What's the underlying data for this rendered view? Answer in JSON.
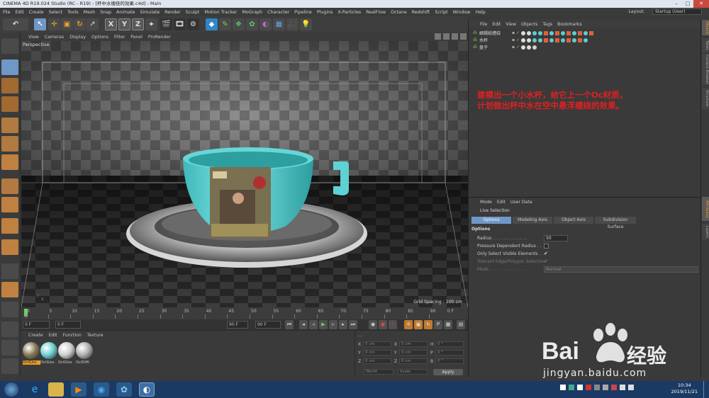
{
  "window": {
    "title": "CINEMA 4D R19.024 Studio (RC - R19) - [杯中水缠绕的效果.c4d] - Main",
    "controls": [
      "–",
      "□",
      "✕"
    ]
  },
  "menubar": {
    "items": [
      "File",
      "Edit",
      "Create",
      "Select",
      "Tools",
      "Mesh",
      "Snap",
      "Animate",
      "Simulate",
      "Render",
      "Sculpt",
      "Motion Tracker",
      "MoGraph",
      "Character",
      "Pipeline",
      "Plugins",
      "X-Particles",
      "RealFlow",
      "Octane",
      "Redshift",
      "Script",
      "Window",
      "Help"
    ],
    "layout_label": "Layout:",
    "layout_value": "Startup (User)"
  },
  "toolbar": {
    "axis_x": "X",
    "axis_y": "Y",
    "axis_z": "Z"
  },
  "viewport": {
    "menu": [
      "View",
      "Cameras",
      "Display",
      "Options",
      "Filter",
      "Panel",
      "ProRender"
    ],
    "label": "Perspective",
    "grid_spacing": "Grid Spacing : 100 cm"
  },
  "timeline": {
    "ticks": [
      "0",
      "5",
      "10",
      "15",
      "20",
      "25",
      "30",
      "35",
      "40",
      "45",
      "50",
      "55",
      "60",
      "65",
      "70",
      "75",
      "80",
      "85",
      "90"
    ],
    "end_frame": "0 F"
  },
  "playbar": {
    "current": "0 F",
    "start": "0 F",
    "end": "90 F",
    "end2": "90 F"
  },
  "materials": {
    "menu": [
      "Create",
      "Edit",
      "Function",
      "Texture"
    ],
    "items": [
      {
        "label": "OctGlos",
        "color": "#8a7a5a"
      },
      {
        "label": "OctGlos",
        "color": "#6fd0d2"
      },
      {
        "label": "OctGlos",
        "color": "#d0d0d0"
      },
      {
        "label": "OctDiffi",
        "color": "#b0b0b0"
      }
    ]
  },
  "coordinates": {
    "rows": [
      {
        "a": "X",
        "v1": "0 cm",
        "b": "X",
        "v2": "0 cm",
        "c": "H",
        "v3": "0 °"
      },
      {
        "a": "Y",
        "v1": "0 cm",
        "b": "Y",
        "v2": "0 cm",
        "c": "P",
        "v3": "0 °"
      },
      {
        "a": "Z",
        "v1": "0 cm",
        "b": "Z",
        "v2": "0 cm",
        "c": "B",
        "v3": "0 °"
      }
    ],
    "mode1": "World",
    "mode2": "Scale",
    "apply": "Apply"
  },
  "objects": {
    "menu": [
      "File",
      "Edit",
      "View",
      "Objects",
      "Tags",
      "Bookmarks"
    ],
    "rows": [
      "細褐纸缠绕",
      "水杯",
      "盘子"
    ]
  },
  "annotation": {
    "line1": "建模出一个小水杯，给它上一个Oc材质，",
    "line2": "计划做出杯中水在空中悬浮缠绕的效果。"
  },
  "attributes": {
    "menu": [
      "Mode",
      "Edit",
      "User Data"
    ],
    "title": "Live Selection",
    "tabs": [
      "Options",
      "Modeling Axis",
      "Object Axis",
      "Subdivision Surface"
    ],
    "section": "Options",
    "radius_label": "Radius . . . . . . . . . . . . .",
    "radius_value": "50",
    "pressure_label": "Pressure Dependent Radius . .",
    "visible_label": "Only Select Visible Elements . .",
    "tolerant_label": "Tolerant Edge/Polygon Selection",
    "mode_label": "Mode . . . . . . . . . . . . . .",
    "mode_value": "Normal"
  },
  "sidetabs": [
    "Objects",
    "Takes",
    "Content Browser",
    "Structure",
    "Attributes",
    "Layers"
  ],
  "watermark": {
    "brand": "Bai",
    "brand2": "经验",
    "url": "jingyan.baidu.com"
  },
  "taskbar": {
    "time": "10:34",
    "date": "2019/11/21"
  }
}
